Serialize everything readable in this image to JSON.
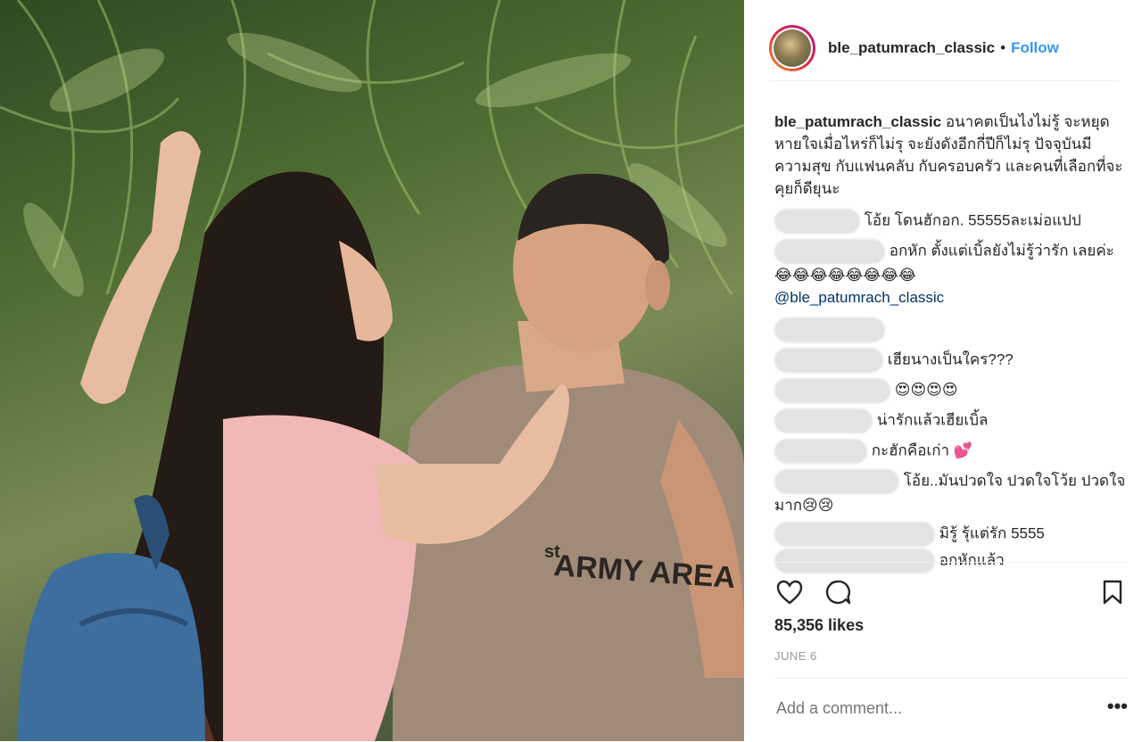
{
  "post": {
    "username": "ble_patumrach_classic",
    "separator": "•",
    "follow_label": "Follow"
  },
  "photo": {
    "shirt_text": "ARMY AREA",
    "shirt_prefix": "st"
  },
  "caption": {
    "username": "ble_patumrach_classic",
    "text": "อนาคตเป็นไงไม่รู้ จะหยุดหายใจเมื่อไหร่ก็ไม่รุ จะยังดังอีกกี่ปีก็ไม่รุ ปัจจุบันมีความสุข กับแฟนคลับ กับครอบครัว และคนที่เลือกที่จะคุยก็ดียุนะ"
  },
  "comments": [
    {
      "text": "โอ้ย โดนฮักอก. 55555ละเม่อแปป"
    },
    {
      "text": "อกหัก ตั้งแต่เบิ้ลยังไม่รู้ว่ารัก เลยค่ะ 😂😂😂😂😂😂😂😂",
      "mention": "@ble_patumrach_classic"
    },
    {
      "text": ""
    },
    {
      "text": "เฮียนางเป็นใคร???"
    },
    {
      "text": "😍😍😍😍"
    },
    {
      "text": "น่ารักแล้วเฮียเบิ้ล"
    },
    {
      "text": "กะฮักคือเก่า 💕"
    },
    {
      "text": "โอ้ย..มันปวดใจ ปวดใจโว้ย ปวดใจมาก😢😢"
    },
    {
      "text": "มิรู้ รุ้แต่รัก 5555"
    },
    {
      "text": "อกหักแล้ว"
    }
  ],
  "likes": "85,356 likes",
  "date": "JUNE 6",
  "add_comment": {
    "placeholder": "Add a comment..."
  },
  "more_label": "•••",
  "icons": {
    "like": "heart-icon",
    "comment": "comment-icon",
    "save": "bookmark-icon"
  }
}
